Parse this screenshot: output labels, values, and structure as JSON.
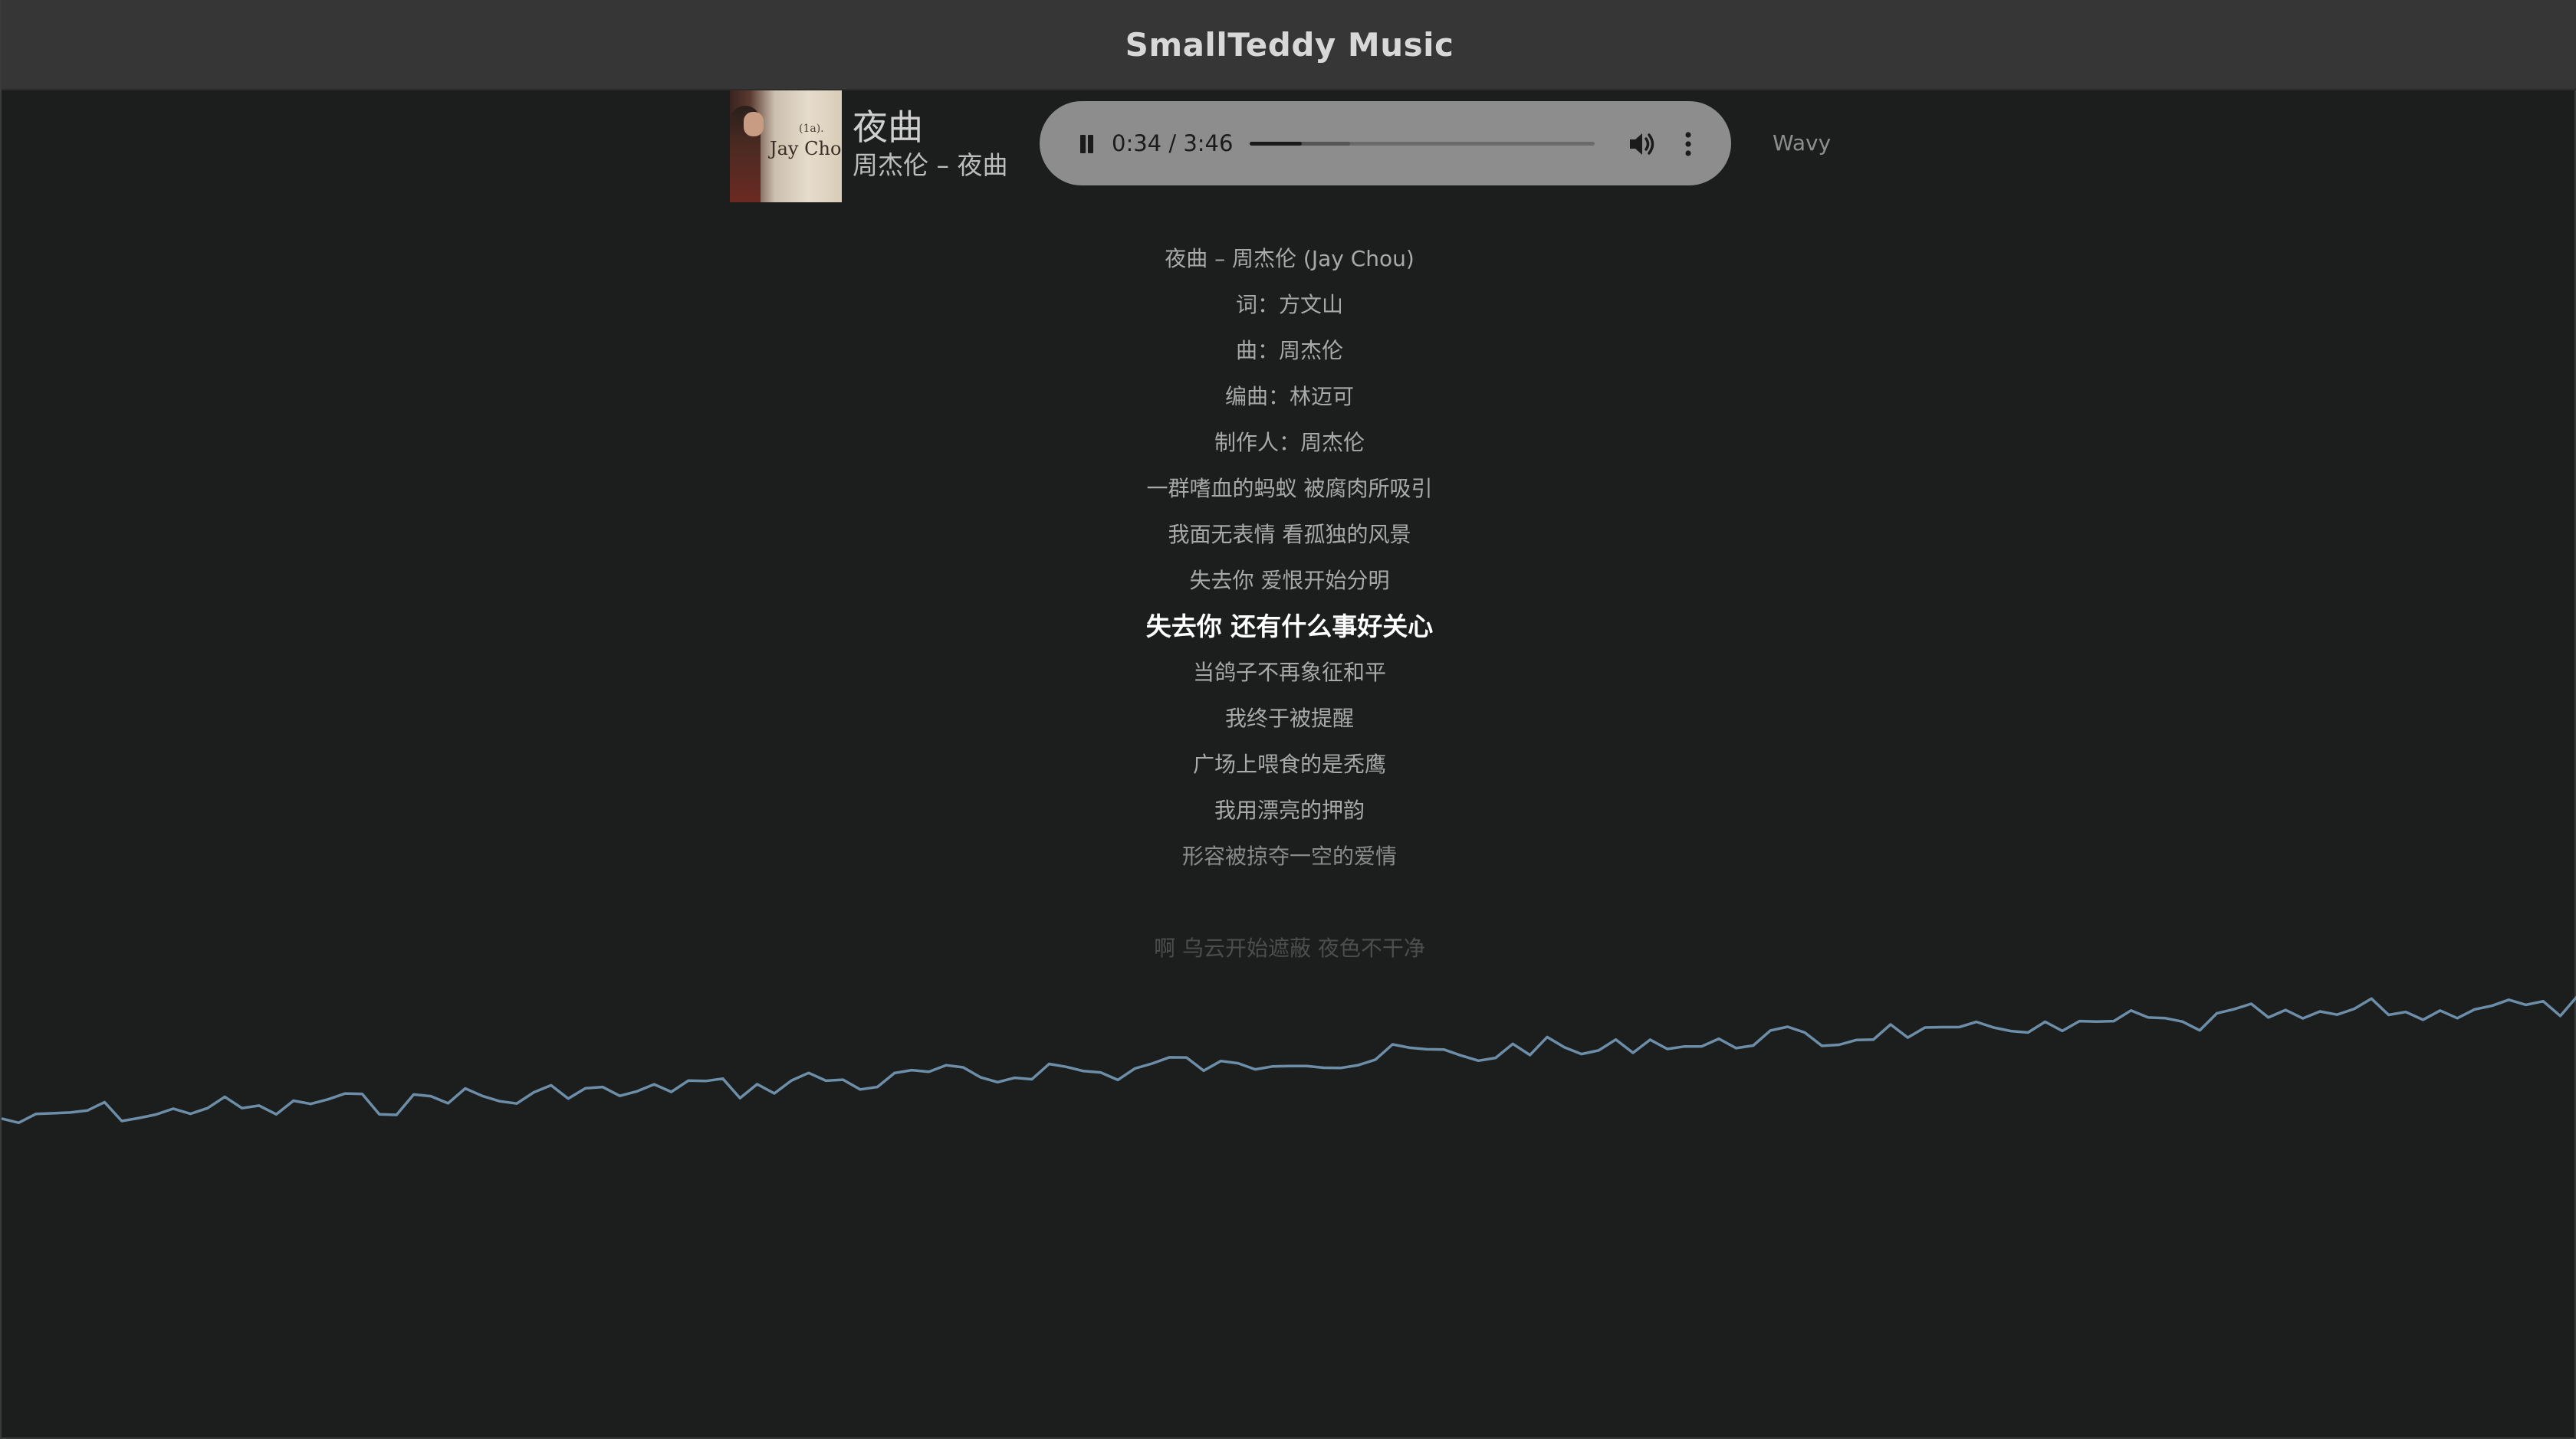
{
  "app": {
    "title": "SmallTeddy Music"
  },
  "now_playing": {
    "title": "夜曲",
    "artist_line": "周杰伦 – 夜曲",
    "cover_text_main": "Jay Chou",
    "cover_text_small": "(1a)."
  },
  "player": {
    "time_display": "0:34 / 3:46",
    "progress_fraction": 0.1504,
    "buffered_fraction": 0.29,
    "state": "playing"
  },
  "visualizer": {
    "label": "Wavy",
    "line_color": "#6d8ea8"
  },
  "lyrics": {
    "lines": [
      "夜曲 – 周杰伦 (Jay Chou)",
      "词：方文山",
      "曲：周杰伦",
      "编曲：林迈可",
      "制作人：周杰伦",
      "一群嗜血的蚂蚁 被腐肉所吸引",
      "我面无表情 看孤独的风景",
      "失去你 爱恨开始分明",
      "失去你 还有什么事好关心",
      "当鸽子不再象征和平",
      "我终于被提醒",
      "广场上喂食的是秃鹰",
      "我用漂亮的押韵",
      "形容被掠夺一空的爱情",
      "啊 乌云开始遮蔽 夜色不干净"
    ],
    "current_index": 8
  },
  "colors": {
    "background": "#1c1e1e",
    "titlebar": "#363636",
    "player_bg": "#8d8d8d",
    "current_lyric": "#ffffff",
    "lyric": "#a9a9a9"
  }
}
